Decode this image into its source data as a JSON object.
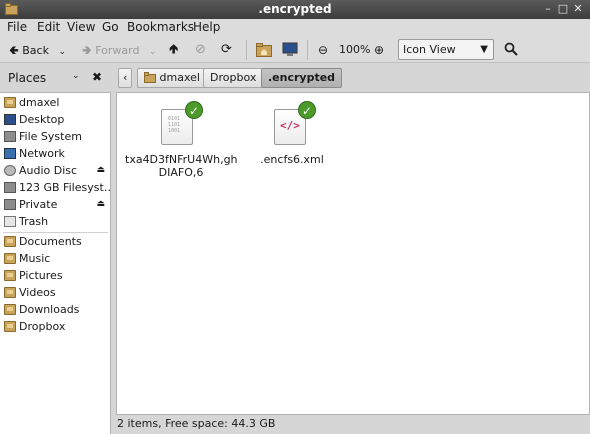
{
  "window": {
    "title": ".encrypted"
  },
  "menu": [
    "File",
    "Edit",
    "View",
    "Go",
    "Bookmarks",
    "Help"
  ],
  "toolbar": {
    "back_label": "Back",
    "forward_label": "Forward",
    "zoom_level": "100%",
    "view_mode": "Icon View"
  },
  "sidebar": {
    "header": "Places",
    "devices": [
      {
        "label": "dmaxel",
        "icon": "home-folder-icon"
      },
      {
        "label": "Desktop",
        "icon": "desktop-icon"
      },
      {
        "label": "File System",
        "icon": "drive-icon"
      },
      {
        "label": "Network",
        "icon": "network-icon"
      },
      {
        "label": "Audio Disc",
        "icon": "cd-icon"
      },
      {
        "label": "123 GB Filesyst…",
        "icon": "drive-icon"
      },
      {
        "label": "Private",
        "icon": "drive-icon"
      },
      {
        "label": "Trash",
        "icon": "trash-icon"
      }
    ],
    "bookmarks": [
      {
        "label": "Documents"
      },
      {
        "label": "Music"
      },
      {
        "label": "Pictures"
      },
      {
        "label": "Videos"
      },
      {
        "label": "Downloads"
      },
      {
        "label": "Dropbox"
      }
    ]
  },
  "breadcrumbs": [
    "dmaxel",
    "Dropbox",
    ".encrypted"
  ],
  "files": [
    {
      "name_line1": "txa4D3fNFrU4Wh,gh",
      "name_line2": "DIAFO,6",
      "type": "binary",
      "badge": "synced-check-icon",
      "bin_text": [
        "0101",
        "1101",
        "1001"
      ]
    },
    {
      "name_line1": ".encfs6.xml",
      "name_line2": "",
      "type": "xml",
      "badge": "synced-check-icon",
      "xml_glyph": "</>"
    }
  ],
  "status": {
    "text": "2 items, Free space: 44.3 GB"
  },
  "colors": {
    "titlebar": "#4a4a4a",
    "sync_badge": "#4c9a2a",
    "folder": "#c9a35a"
  }
}
